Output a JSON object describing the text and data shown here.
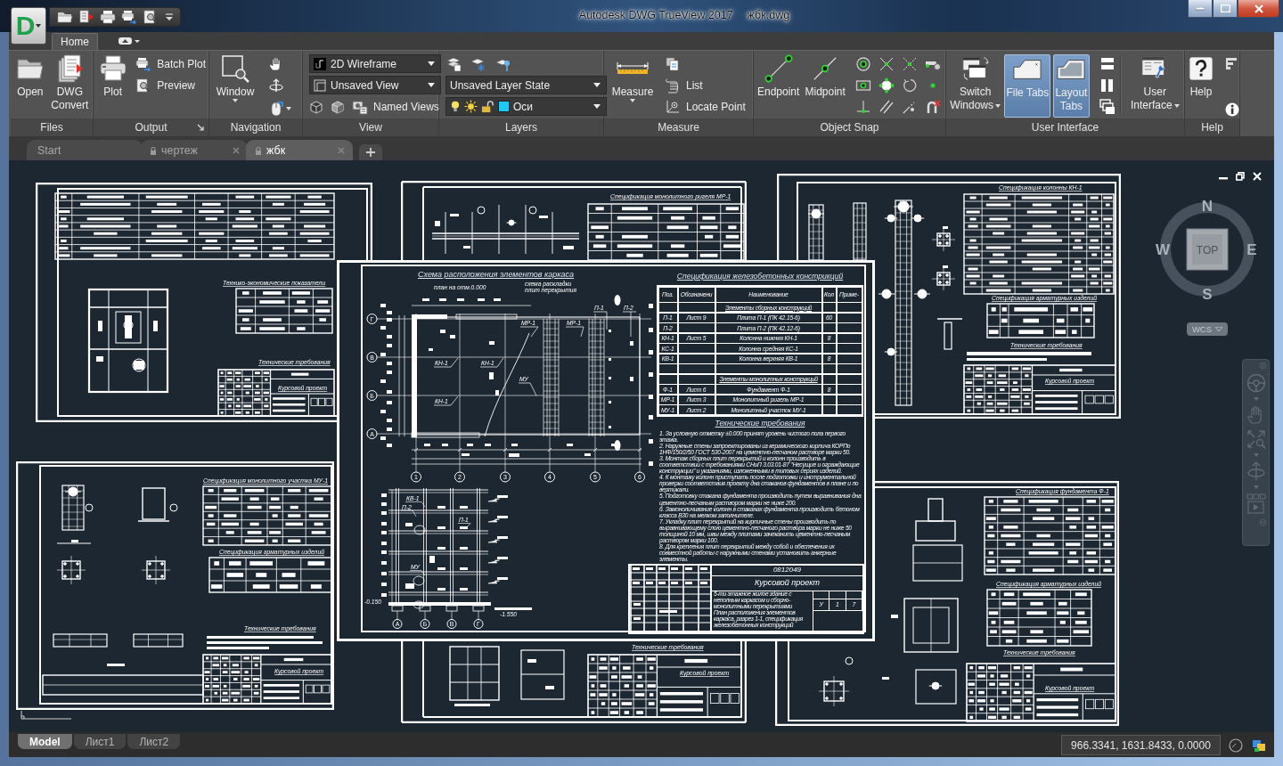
{
  "window": {
    "app_letter": "D",
    "title": "Autodesk DWG TrueView 2017",
    "document": "жбк.dwg"
  },
  "ribbon": {
    "tabs": [
      {
        "label": "Home",
        "selected": true
      }
    ],
    "files": {
      "title": "Files",
      "buttons": [
        "Open",
        "DWG Convert"
      ]
    },
    "output": {
      "title": "Output",
      "large_button": "Plot",
      "small_buttons": [
        "Batch Plot",
        "Preview"
      ]
    },
    "navigation": {
      "title": "Navigation",
      "large_button": "Window"
    },
    "view": {
      "title": "View",
      "visual_style": "2D Wireframe",
      "named_view": "Unsaved View",
      "named_views_button": "Named Views"
    },
    "layers": {
      "title": "Layers",
      "layer_state": "Unsaved Layer State",
      "current_layer": {
        "name": "Оси",
        "on": true,
        "frozen": false,
        "locked": false,
        "color": "#1ec8f5"
      }
    },
    "measure": {
      "title": "Measure",
      "large_button": "Measure",
      "small_buttons": [
        "List",
        "Locate Point"
      ]
    },
    "object_snap": {
      "title": "Object Snap",
      "large_buttons": [
        "Endpoint",
        "Midpoint"
      ]
    },
    "user_interface": {
      "title": "User Interface",
      "switch_windows": "Switch Windows",
      "toggles": [
        {
          "label": "File Tabs",
          "on": true
        },
        {
          "label": "Layout Tabs",
          "on": true
        }
      ],
      "large_button": "User Interface"
    },
    "help": {
      "title": "Help",
      "large_button": "Help"
    }
  },
  "file_tabs": [
    {
      "label": "Start",
      "kind": "start",
      "selected": false
    },
    {
      "label": "чертеж",
      "kind": "drawing",
      "selected": false
    },
    {
      "label": "жбк",
      "kind": "drawing",
      "selected": true
    }
  ],
  "viewport": {
    "background_sheets": [
      {
        "texts": [
          "Технико-экономические показатели",
          "Технические требования",
          "Курсовой проект"
        ]
      },
      {
        "texts": [
          "Спецификация монолитного ригеля МР-1"
        ]
      },
      {
        "texts": [
          "Спецификация колонны КН-1",
          "Спецификация арматурных изделий",
          "Технические требования",
          "Курсовой проект"
        ]
      },
      {
        "texts": [
          "Спецификация монолитного участка МУ-1",
          "Спецификация арматурных изделий",
          "Технические требования",
          "Курсовой проект"
        ]
      },
      {
        "texts": [
          "Технические требования",
          "Курсовой проект"
        ]
      },
      {
        "texts": [
          "Спецификация фундамента Ф-1",
          "Спецификация арматурных изделий",
          "Технические требования",
          "Курсовой проект"
        ]
      }
    ],
    "main_sheet": {
      "plan": {
        "title": "Схема расположения элементов каркаса",
        "captions": [
          "план на отм.0.000",
          "схема раскладки плит перекрытия"
        ],
        "row_axes": [
          "Г",
          "В",
          "Б",
          "А"
        ],
        "column_axes": [
          "1",
          "2",
          "3",
          "4",
          "5",
          "6"
        ],
        "labels": [
          "П-1",
          "П-2",
          "МР-1",
          "МР-1",
          "КН-1",
          "КН-1",
          "МУ",
          "КН-1"
        ]
      },
      "section": {
        "axes": [
          "А",
          "Б",
          "В",
          "Г"
        ],
        "labels": [
          "КВ-1",
          "П-2",
          "П-1",
          "МУ"
        ],
        "levels": [
          "-0.150",
          "-1.550"
        ]
      },
      "specification": {
        "title": "Спецификация железобетонных констрикций",
        "columns": [
          "Поз.",
          "Обозначени",
          "Наименование",
          "Кол",
          "Приме-"
        ],
        "rows": [
          {
            "kind": "group",
            "name": "Элементы сборных конструкций"
          },
          {
            "kind": "item",
            "position": "П-1",
            "document": "Лист 9",
            "name": "Плита П-1 (ПК 42.15-6)",
            "quantity": "60"
          },
          {
            "kind": "item",
            "position": "П-2",
            "name": "Плита П-2 (ПК 42.12-6)"
          },
          {
            "kind": "item",
            "position": "КН-1",
            "document": "Лист 5",
            "name": "Колонна нижняя КН-1",
            "quantity": "8"
          },
          {
            "kind": "item",
            "position": "КС-1",
            "name": "Колонна средняя КС-1"
          },
          {
            "kind": "item",
            "position": "КВ-1",
            "name": "Колонна верхняя КВ-1",
            "quantity": "8"
          },
          {
            "kind": "blank"
          },
          {
            "kind": "group",
            "name": "Элементы монолитных конструкций"
          },
          {
            "kind": "item",
            "position": "Ф-1",
            "document": "Лист 6",
            "name": "Фундамент Ф-1",
            "quantity": "8"
          },
          {
            "kind": "item",
            "position": "МР-1",
            "document": "Лист 3",
            "name": "Монолитный ригель МР-1"
          },
          {
            "kind": "item",
            "position": "МУ-1",
            "document": "Лист 2",
            "name": "Монолитный участок МУ-1"
          }
        ]
      },
      "requirements": {
        "title": "Технические требования",
        "items": [
          "1. За условную отметку ±0.000 принят уровень чистого пола первого этажа.",
          "2. Наружные стены запроектированы из керамического кирпича КОРПо 1НФ/150/2/50 ГОСТ 530-2007 на цементно-песчаном растворе марки 50.",
          "3. Монтаж сборных плит перекрытий и колонн производить в соответствии с требованиями СНиП 3.03.01-87 \"Несущие и ограждающие конструкции\" и указаниями, изложенными в типовых сериях изделий.",
          "4. К монтажу колонн приступать после подготовки и инструментальной проверки соответствия проекту дна стаканов фундаментов в плане и по вертикали.",
          "5. Подготовку стакана фундамента производить путем выравнивания дна цементно-песчаным раствором марки не ниже 200.",
          "6. Замоноличивание колонн в стаканах фундамента производить бетоном класса В30 на мелком заполнителе.",
          "7. Укладку плит перекрытий на кирпичные стены производить по выравнивающему слою цементно-песчаного раствора марки не ниже 50 толщиной 10 мм, швы между плитами зачеканить цементно-песчаным раствором марки 100.",
          "8. Для крепления плит перекрытий между собой и обеспечения их совместной работы с наружными стенами установить анкерные элементы."
        ]
      },
      "title_block": {
        "code": "0812049",
        "title": "Курсовой проект",
        "descriptions": [
          "5-ти этажное жилое здание с неполным каркасом и сборно-монолитными перекрытиями",
          "План расположения элементов каркаса, разрез 1-1, спецификация железобетонных конструкций"
        ],
        "stage": "У",
        "sheet": "1",
        "sheets": "7"
      }
    },
    "viewcube": {
      "north": "N",
      "east": "E",
      "south": "S",
      "west": "W",
      "face": "TOP",
      "coordinate_system": "WCS"
    }
  },
  "layout_tabs": [
    {
      "label": "Model",
      "selected": true
    },
    {
      "label": "Лист1",
      "selected": false
    },
    {
      "label": "Лист2",
      "selected": false
    }
  ],
  "status_bar": {
    "coordinates": "966.3341, 1631.8433, 0.0000"
  }
}
